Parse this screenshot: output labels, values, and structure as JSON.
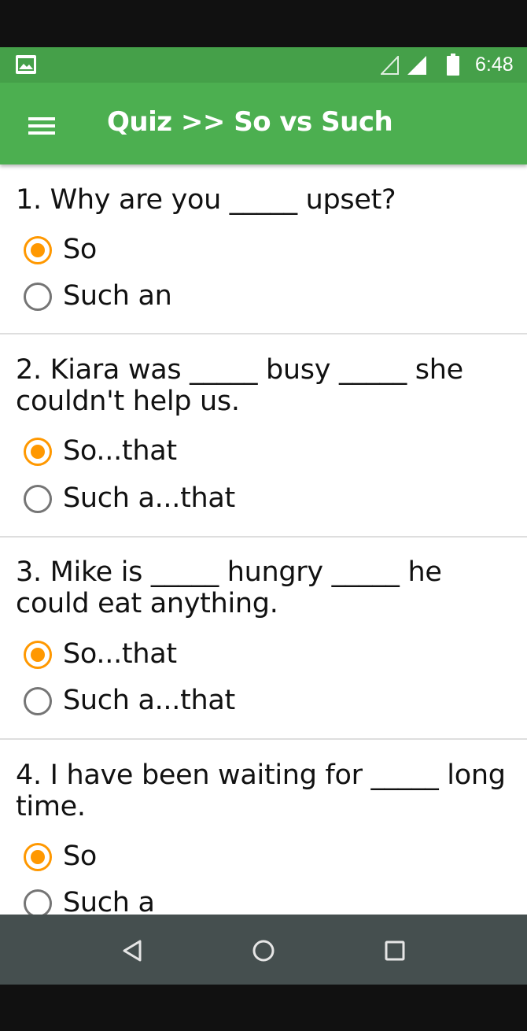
{
  "status_bar": {
    "time": "6:48",
    "icons": [
      "picture-icon",
      "signal-outline-icon",
      "signal-icon",
      "battery-icon"
    ]
  },
  "app_bar": {
    "title": "Quiz >> So vs Such",
    "menu_icon": "hamburger-menu-icon"
  },
  "questions": [
    {
      "text": "1. Why are you _____ upset?",
      "options": [
        {
          "label": "So",
          "selected": true
        },
        {
          "label": "Such an",
          "selected": false
        }
      ]
    },
    {
      "text": "2. Kiara was _____ busy _____ she couldn't help us.",
      "options": [
        {
          "label": "So...that",
          "selected": true
        },
        {
          "label": "Such a...that",
          "selected": false
        }
      ]
    },
    {
      "text": "3. Mike is _____ hungry _____ he could eat anything.",
      "options": [
        {
          "label": "So...that",
          "selected": true
        },
        {
          "label": "Such a...that",
          "selected": false
        }
      ]
    },
    {
      "text": "4. I have been waiting for _____ long time.",
      "options": [
        {
          "label": "So",
          "selected": true
        },
        {
          "label": "Such a",
          "selected": false
        }
      ]
    }
  ],
  "nav_bar": {
    "buttons": [
      "back-icon",
      "home-icon",
      "recents-icon"
    ]
  },
  "colors": {
    "status_bar": "#45A049",
    "app_bar": "#4CAF50",
    "radio_selected": "#FF9800",
    "radio_unselected": "#757575",
    "nav_bar": "#454F4F"
  }
}
